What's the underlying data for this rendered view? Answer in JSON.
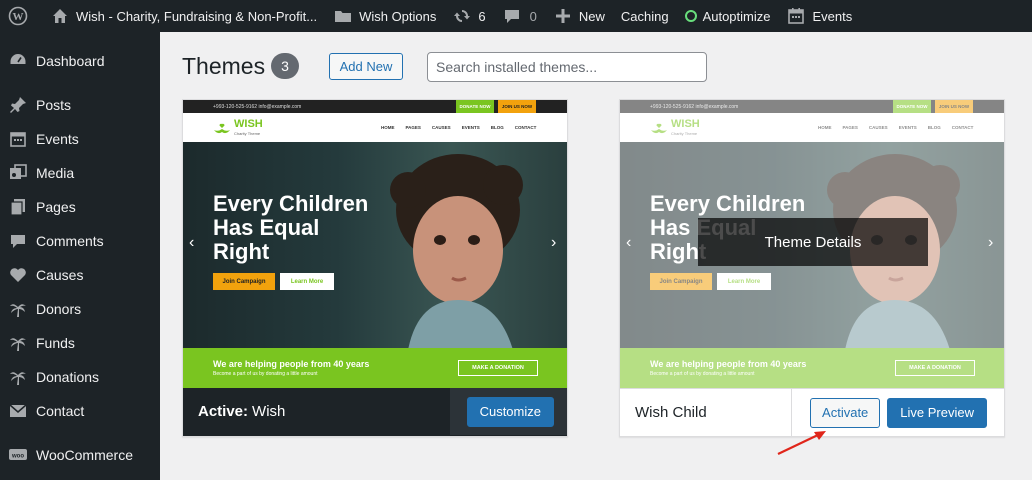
{
  "adminbar": {
    "site_name": "Wish - Charity, Fundraising & Non-Profit...",
    "wish_options": "Wish Options",
    "updates_count": "6",
    "comments_count": "0",
    "new_label": "New",
    "caching_label": "Caching",
    "autoptimize_label": "Autoptimize",
    "events_label": "Events"
  },
  "sidebar": {
    "items": [
      {
        "label": "Dashboard",
        "icon": "dashboard-icon"
      },
      {
        "label": "Posts",
        "icon": "pin-icon"
      },
      {
        "label": "Events",
        "icon": "calendar-icon"
      },
      {
        "label": "Media",
        "icon": "media-icon"
      },
      {
        "label": "Pages",
        "icon": "pages-icon"
      },
      {
        "label": "Comments",
        "icon": "comment-icon"
      },
      {
        "label": "Causes",
        "icon": "heart-icon"
      },
      {
        "label": "Donors",
        "icon": "palm-icon"
      },
      {
        "label": "Funds",
        "icon": "palm-icon"
      },
      {
        "label": "Donations",
        "icon": "palm-icon"
      },
      {
        "label": "Contact",
        "icon": "envelope-icon"
      },
      {
        "label": "WooCommerce",
        "icon": "woo-icon"
      }
    ]
  },
  "header": {
    "title": "Themes",
    "count": "3",
    "add_new_label": "Add New",
    "search_placeholder": "Search installed themes..."
  },
  "preview": {
    "topbar_info": "+993-120-525-9162    info@example.com",
    "donate_now": "DONATE NOW",
    "join_us_now": "JOIN US NOW",
    "logo_name": "WISH",
    "logo_sub": "Charity Theme",
    "nav_links": [
      "HOME",
      "PAGES",
      "CAUSES",
      "EVENTS",
      "BLOG",
      "CONTACT"
    ],
    "hero_line1": "Every Children",
    "hero_line2": "Has Equal",
    "hero_line3": "Right",
    "join_campaign": "Join Campaign",
    "learn_more": "Learn More",
    "band_title": "We are helping people from 40 years",
    "band_sub": "Become a part of us by donating a little amount",
    "make_donation": "MAKE A DONATION"
  },
  "themes": [
    {
      "active_label": "Active:",
      "name": "Wish",
      "action": "Customize"
    },
    {
      "name": "Wish Child",
      "overlay": "Theme Details",
      "activate": "Activate",
      "live_preview": "Live Preview"
    }
  ],
  "colors": {
    "accent": "#2271b1",
    "adminbar_bg": "#1d2327",
    "brand_green": "#7ac520",
    "brand_orange": "#f2a20d",
    "annotation_arrow": "#e0261b"
  }
}
